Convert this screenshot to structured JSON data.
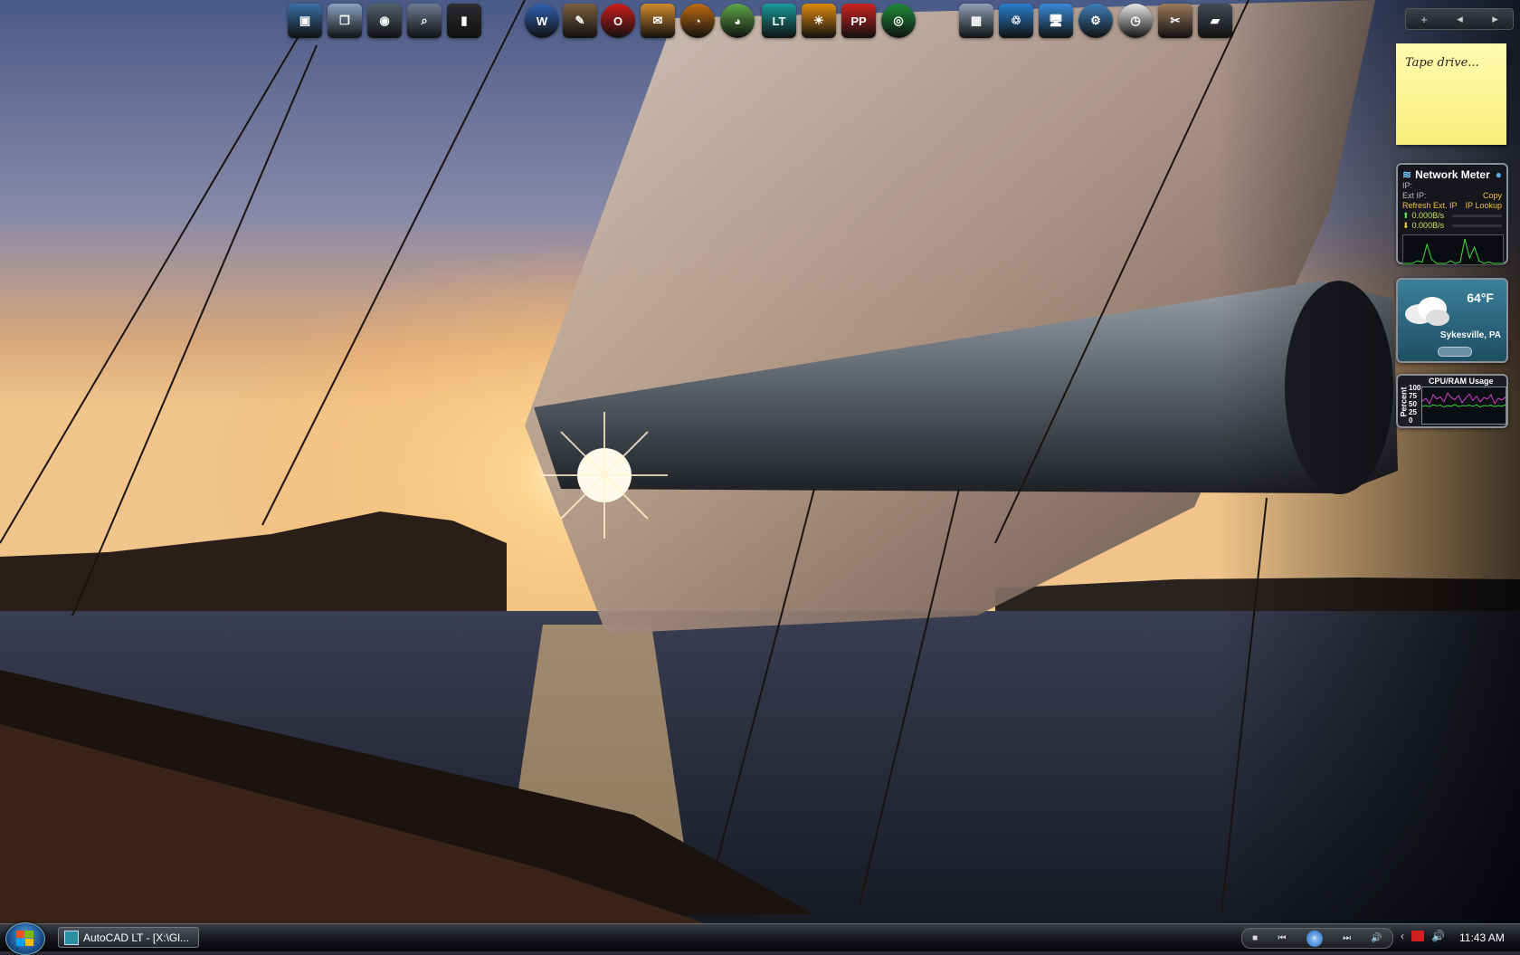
{
  "taskbar": {
    "start_label": "Start",
    "tasks": [
      {
        "label": "AutoCAD LT - [X:\\Gl..."
      }
    ],
    "media": {
      "stop": "■",
      "prev": "⏮",
      "play": "⏸",
      "next": "⏭",
      "volume": "🔊"
    },
    "tray": {
      "expand": "‹",
      "volume": "🔊"
    },
    "clock": "11:43 AM"
  },
  "dock": {
    "icons": [
      {
        "name": "display-properties-icon",
        "glyph": "▣",
        "color": "#3a6fa8"
      },
      {
        "name": "file-manager-icon",
        "glyph": "❐",
        "color": "#8aa4c0"
      },
      {
        "name": "camera-icon",
        "glyph": "◉",
        "color": "#556070"
      },
      {
        "name": "search-files-icon",
        "glyph": "⌕",
        "color": "#6d7a90"
      },
      {
        "name": "computer-tower-icon",
        "glyph": "▮",
        "color": "#2a2c30"
      },
      {
        "name": "word-icon",
        "glyph": "W",
        "color": "#2f5fb0"
      },
      {
        "name": "gimp-icon",
        "glyph": "✎",
        "color": "#7a6040"
      },
      {
        "name": "opera-icon",
        "glyph": "O",
        "color": "#cc1b1b"
      },
      {
        "name": "mail-icon",
        "glyph": "✉",
        "color": "#d08a2a"
      },
      {
        "name": "speedometer-icon",
        "glyph": "◔",
        "color": "#c06a10"
      },
      {
        "name": "picasa-icon",
        "glyph": "◕",
        "color": "#5ea848"
      },
      {
        "name": "autocad-lt-icon",
        "glyph": "LT",
        "color": "#1a9a9a"
      },
      {
        "name": "sun-icon",
        "glyph": "☀",
        "color": "#e08a10"
      },
      {
        "name": "pp-plus-icon",
        "glyph": "PP",
        "color": "#cc2222"
      },
      {
        "name": "green-globe-icon",
        "glyph": "◎",
        "color": "#1e8a3a"
      },
      {
        "name": "calculator-icon",
        "glyph": "▦",
        "color": "#8ea0b8"
      },
      {
        "name": "recycle-bin-icon",
        "glyph": "♲",
        "color": "#2a7fd0"
      },
      {
        "name": "network-computer-icon",
        "glyph": "🖥",
        "color": "#3a8ad8"
      },
      {
        "name": "settings-gear-icon",
        "glyph": "⚙",
        "color": "#3f7fb8"
      },
      {
        "name": "clock-icon",
        "glyph": "◷",
        "color": "#e8e8e8"
      },
      {
        "name": "tools-icon",
        "glyph": "✂",
        "color": "#9a7a5a"
      },
      {
        "name": "monitor-icon",
        "glyph": "▰",
        "color": "#444a55"
      }
    ]
  },
  "sidebar": {
    "controls": {
      "add": "+",
      "prev": "◂",
      "next": "▸"
    },
    "sticky_note": {
      "text": "Tape drive..."
    },
    "network_meter": {
      "title": "Network Meter",
      "ip_label": "IP:",
      "ext_ip_label": "Ext IP:",
      "copy_label": "Copy",
      "refresh_label": "Refresh Ext. IP",
      "lookup_label": "IP Lookup",
      "up_speed": "0.000B/s",
      "down_speed": "0.000B/s",
      "graph": [
        0,
        0,
        0,
        2,
        1,
        14,
        3,
        0,
        0,
        0,
        2,
        0,
        1,
        18,
        4,
        12,
        2,
        0,
        1,
        0,
        0,
        0
      ]
    },
    "weather": {
      "temp": "64°F",
      "city": "Sykesville, PA"
    },
    "cpu_ram": {
      "title": "CPU/RAM Usage",
      "axis_title": "Percent",
      "ticks": [
        "100",
        "75",
        "50",
        "25",
        "0"
      ],
      "cpu_series": [
        62,
        70,
        55,
        80,
        68,
        74,
        60,
        85,
        72,
        66,
        78,
        58,
        70,
        82,
        64,
        76,
        60,
        72,
        68,
        80,
        55,
        70,
        65,
        74
      ],
      "ram_series": [
        48,
        50,
        47,
        52,
        49,
        51,
        46,
        50,
        48,
        53,
        47,
        50,
        49,
        51,
        48,
        52,
        46,
        50,
        49,
        51,
        47,
        50,
        48,
        52
      ]
    }
  },
  "colors": {
    "taskbar_top": "#3a3e46",
    "taskbar_bottom": "#050608",
    "sticky_yellow": "#f7ee7a",
    "weather_teal": "#2f6f88",
    "cpu_line": "#d040d0",
    "ram_line": "#40d040"
  }
}
